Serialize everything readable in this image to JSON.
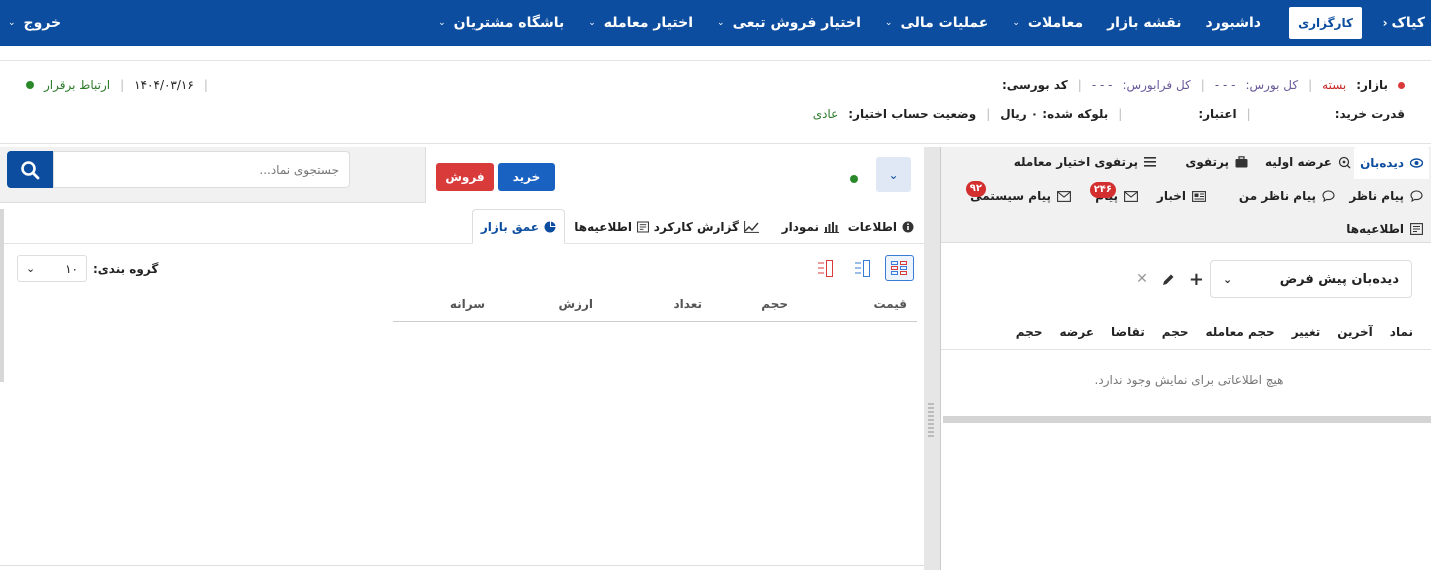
{
  "nav": {
    "brand": "کیاک",
    "brand_chevron": "‹",
    "kargozari": "کارگزاری",
    "menu": [
      {
        "label": "داشبورد",
        "dropdown": false
      },
      {
        "label": "نقشه بازار",
        "dropdown": false
      },
      {
        "label": "معاملات",
        "dropdown": true
      },
      {
        "label": "عملیات مالی",
        "dropdown": true
      },
      {
        "label": "اختیار فروش تبعی",
        "dropdown": true
      },
      {
        "label": "اختیار معامله",
        "dropdown": true
      },
      {
        "label": "باشگاه مشتریان",
        "dropdown": true
      }
    ],
    "exit": "خروج",
    "dropdown_glyph": "⌄"
  },
  "info": {
    "market_label": "بازار:",
    "market_value": "بسته",
    "total_bourse_label": "کل بورس:",
    "total_bourse_value": "- - -",
    "total_farabourse_label": "کل فرابورس:",
    "total_farabourse_value": "- - -",
    "code_label": "کد بورسی:",
    "code_value": "",
    "buy_power_label": "قدرت خرید:",
    "buy_power_value": "",
    "credit_label": "اعتبار:",
    "credit_value": "",
    "blocked": "بلوکه شده: ۰ ریال",
    "option_status_label": "وضعیت حساب اختیار:",
    "option_status_value": "عادی",
    "date": "۱۴۰۴/۰۳/۱۶",
    "connection": "ارتباط برقرار",
    "sep": "|"
  },
  "right_panel": {
    "tabs": [
      {
        "label": "دیده‌بان",
        "icon": "eye-icon",
        "active": true
      },
      {
        "label": "عرضه اولیه",
        "icon": "ipo-icon"
      },
      {
        "label": "پرتفوی",
        "icon": "briefcase-icon"
      },
      {
        "label": "پرتفوی اختیار معامله",
        "icon": "list-icon"
      },
      {
        "label": "پیام ناظر",
        "icon": "chat-icon"
      },
      {
        "label": "پیام ناظر من",
        "icon": "chat-icon"
      },
      {
        "label": "اخبار",
        "icon": "news-icon"
      },
      {
        "label": "پیام",
        "icon": "mail-icon",
        "badge": "۲۴۶"
      },
      {
        "label": "پیام سیستمی",
        "icon": "mail-icon",
        "badge": "۹۲"
      },
      {
        "label": "اطلاعیه‌ها",
        "icon": "notice-icon"
      }
    ],
    "watchlist_select": "دیده‌بان پیش فرض",
    "columns": [
      "نماد",
      "آخرین",
      "تغییر",
      "حجم معامله",
      "حجم",
      "تقاضا",
      "عرضه",
      "حجم"
    ],
    "empty_text": "هیچ اطلاعاتی برای نمایش وجود ندارد."
  },
  "left_panel": {
    "buy_label": "خرید",
    "sell_label": "فروش",
    "search_placeholder": "جستجوی نماد...",
    "subtabs": [
      {
        "label": "اطلاعات",
        "icon": "info-icon"
      },
      {
        "label": "نمودار",
        "icon": "bar-chart-icon"
      },
      {
        "label": "گزارش کارکرد",
        "icon": "line-chart-icon"
      },
      {
        "label": "اطلاعیه‌ها",
        "icon": "notice-icon"
      },
      {
        "label": "عمق بازار",
        "icon": "pie-chart-icon",
        "active": true
      }
    ],
    "group_label": "گروه بندی:",
    "group_value": "۱۰",
    "columns": [
      "قیمت",
      "حجم",
      "تعداد",
      "ارزش",
      "سرانه"
    ]
  },
  "colors": {
    "nav_bg": "#0c4d9f",
    "buy": "#1a62c2",
    "sell": "#d93a3a",
    "status_green": "#2a8a2a",
    "badge_red": "#d32f2f"
  }
}
